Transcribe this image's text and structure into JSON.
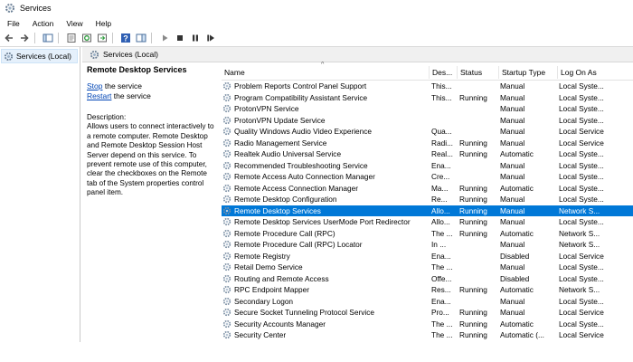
{
  "window": {
    "title": "Services"
  },
  "menu": [
    "File",
    "Action",
    "View",
    "Help"
  ],
  "tree": {
    "root_label": "Services (Local)"
  },
  "header": {
    "label": "Services (Local)"
  },
  "description_panel": {
    "service_title": "Remote Desktop Services",
    "stop_link": "Stop",
    "stop_suffix": " the service",
    "restart_link": "Restart",
    "restart_suffix": " the service",
    "description_label": "Description:",
    "description_text": "Allows users to connect interactively to a remote computer. Remote Desktop and Remote Desktop Session Host Server depend on this service. To prevent remote use of this computer, clear the checkboxes on the Remote tab of the System properties control panel item."
  },
  "columns": {
    "name": "Name",
    "desc": "Des...",
    "status": "Status",
    "startup": "Startup Type",
    "logon": "Log On As"
  },
  "services": [
    {
      "name": "Problem Reports Control Panel Support",
      "desc": "This...",
      "status": "",
      "startup": "Manual",
      "logon": "Local Syste..."
    },
    {
      "name": "Program Compatibility Assistant Service",
      "desc": "This...",
      "status": "Running",
      "startup": "Manual",
      "logon": "Local Syste..."
    },
    {
      "name": "ProtonVPN Service",
      "desc": "",
      "status": "",
      "startup": "Manual",
      "logon": "Local Syste..."
    },
    {
      "name": "ProtonVPN Update Service",
      "desc": "",
      "status": "",
      "startup": "Manual",
      "logon": "Local Syste..."
    },
    {
      "name": "Quality Windows Audio Video Experience",
      "desc": "Qua...",
      "status": "",
      "startup": "Manual",
      "logon": "Local Service"
    },
    {
      "name": "Radio Management Service",
      "desc": "Radi...",
      "status": "Running",
      "startup": "Manual",
      "logon": "Local Service"
    },
    {
      "name": "Realtek Audio Universal Service",
      "desc": "Real...",
      "status": "Running",
      "startup": "Automatic",
      "logon": "Local Syste..."
    },
    {
      "name": "Recommended Troubleshooting Service",
      "desc": "Ena...",
      "status": "",
      "startup": "Manual",
      "logon": "Local Syste..."
    },
    {
      "name": "Remote Access Auto Connection Manager",
      "desc": "Cre...",
      "status": "",
      "startup": "Manual",
      "logon": "Local Syste..."
    },
    {
      "name": "Remote Access Connection Manager",
      "desc": "Ma...",
      "status": "Running",
      "startup": "Automatic",
      "logon": "Local Syste..."
    },
    {
      "name": "Remote Desktop Configuration",
      "desc": "Re...",
      "status": "Running",
      "startup": "Manual",
      "logon": "Local Syste..."
    },
    {
      "name": "Remote Desktop Services",
      "desc": "Allo...",
      "status": "Running",
      "startup": "Manual",
      "logon": "Network S...",
      "selected": true
    },
    {
      "name": "Remote Desktop Services UserMode Port Redirector",
      "desc": "Allo...",
      "status": "Running",
      "startup": "Manual",
      "logon": "Local Syste..."
    },
    {
      "name": "Remote Procedure Call (RPC)",
      "desc": "The ...",
      "status": "Running",
      "startup": "Automatic",
      "logon": "Network S..."
    },
    {
      "name": "Remote Procedure Call (RPC) Locator",
      "desc": "In ...",
      "status": "",
      "startup": "Manual",
      "logon": "Network S..."
    },
    {
      "name": "Remote Registry",
      "desc": "Ena...",
      "status": "",
      "startup": "Disabled",
      "logon": "Local Service"
    },
    {
      "name": "Retail Demo Service",
      "desc": "The ...",
      "status": "",
      "startup": "Manual",
      "logon": "Local Syste..."
    },
    {
      "name": "Routing and Remote Access",
      "desc": "Offe...",
      "status": "",
      "startup": "Disabled",
      "logon": "Local Syste..."
    },
    {
      "name": "RPC Endpoint Mapper",
      "desc": "Res...",
      "status": "Running",
      "startup": "Automatic",
      "logon": "Network S..."
    },
    {
      "name": "Secondary Logon",
      "desc": "Ena...",
      "status": "",
      "startup": "Manual",
      "logon": "Local Syste..."
    },
    {
      "name": "Secure Socket Tunneling Protocol Service",
      "desc": "Pro...",
      "status": "Running",
      "startup": "Manual",
      "logon": "Local Service"
    },
    {
      "name": "Security Accounts Manager",
      "desc": "The ...",
      "status": "Running",
      "startup": "Automatic",
      "logon": "Local Syste..."
    },
    {
      "name": "Security Center",
      "desc": "The ...",
      "status": "Running",
      "startup": "Automatic (...",
      "logon": "Local Service"
    }
  ],
  "colors": {
    "selection": "#0078d7",
    "link": "#0045b5",
    "header_bg": "#f0f0f0"
  }
}
